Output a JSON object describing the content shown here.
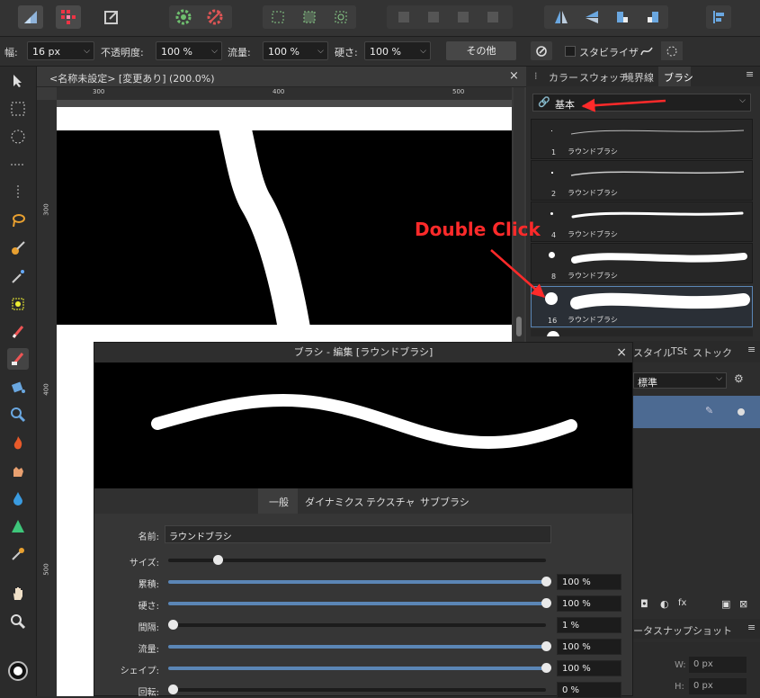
{
  "context_bar": {
    "width_label": "幅:",
    "width_value": "16 px",
    "opacity_label": "不透明度:",
    "opacity_value": "100 %",
    "flow_label": "流量:",
    "flow_value": "100 %",
    "hardness_label": "硬さ:",
    "hardness_value": "100 %",
    "more_label": "その他",
    "stabilize_label": "スタビライザ"
  },
  "document": {
    "title": "<名称未設定> [変更あり] (200.0%)",
    "close": "×",
    "ruler_top": [
      "300",
      "400",
      "500"
    ],
    "ruler_left": [
      "300",
      "400",
      "500"
    ]
  },
  "right_panel": {
    "tabs": [
      "カラー",
      "スウォッチ",
      "境界線",
      "ブラシ"
    ],
    "category": "基本",
    "brushes": [
      {
        "size": "1",
        "name": "ラウンドブラシ"
      },
      {
        "size": "2",
        "name": "ラウンドブラシ"
      },
      {
        "size": "4",
        "name": "ラウンドブラシ"
      },
      {
        "size": "8",
        "name": "ラウンドブラシ"
      },
      {
        "size": "16",
        "name": "ラウンドブラシ"
      }
    ],
    "layer_tabs": [
      "スタイル",
      "TSt",
      "ストック"
    ],
    "blend_mode": "標準",
    "bottom_tabs": [
      "ータ",
      "スナップショット"
    ],
    "w_label": "W:",
    "w_value": "0 px",
    "h_label": "H:",
    "h_value": "0 px"
  },
  "annotation": {
    "text": "Double Click",
    "color": "#ff2a2a"
  },
  "dialog": {
    "title": "ブラシ - 編集 [ラウンドブラシ]",
    "close": "×",
    "tabs": [
      "一般",
      "ダイナミクス",
      "テクスチャ",
      "サブブラシ"
    ],
    "name_label": "名前:",
    "name_value": "ラウンドブラシ",
    "params": [
      {
        "label": "サイズ:",
        "value": "",
        "level": 0.13,
        "fill": false
      },
      {
        "label": "累積:",
        "value": "100 %",
        "level": 1.0,
        "fill": true
      },
      {
        "label": "硬さ:",
        "value": "100 %",
        "level": 1.0,
        "fill": true
      },
      {
        "label": "間隔:",
        "value": "1 %",
        "level": 0.01,
        "fill": false
      },
      {
        "label": "流量:",
        "value": "100 %",
        "level": 1.0,
        "fill": true
      },
      {
        "label": "シェイプ:",
        "value": "100 %",
        "level": 1.0,
        "fill": true
      },
      {
        "label": "回転:",
        "value": "0 %",
        "level": 0.0,
        "fill": false
      }
    ]
  }
}
